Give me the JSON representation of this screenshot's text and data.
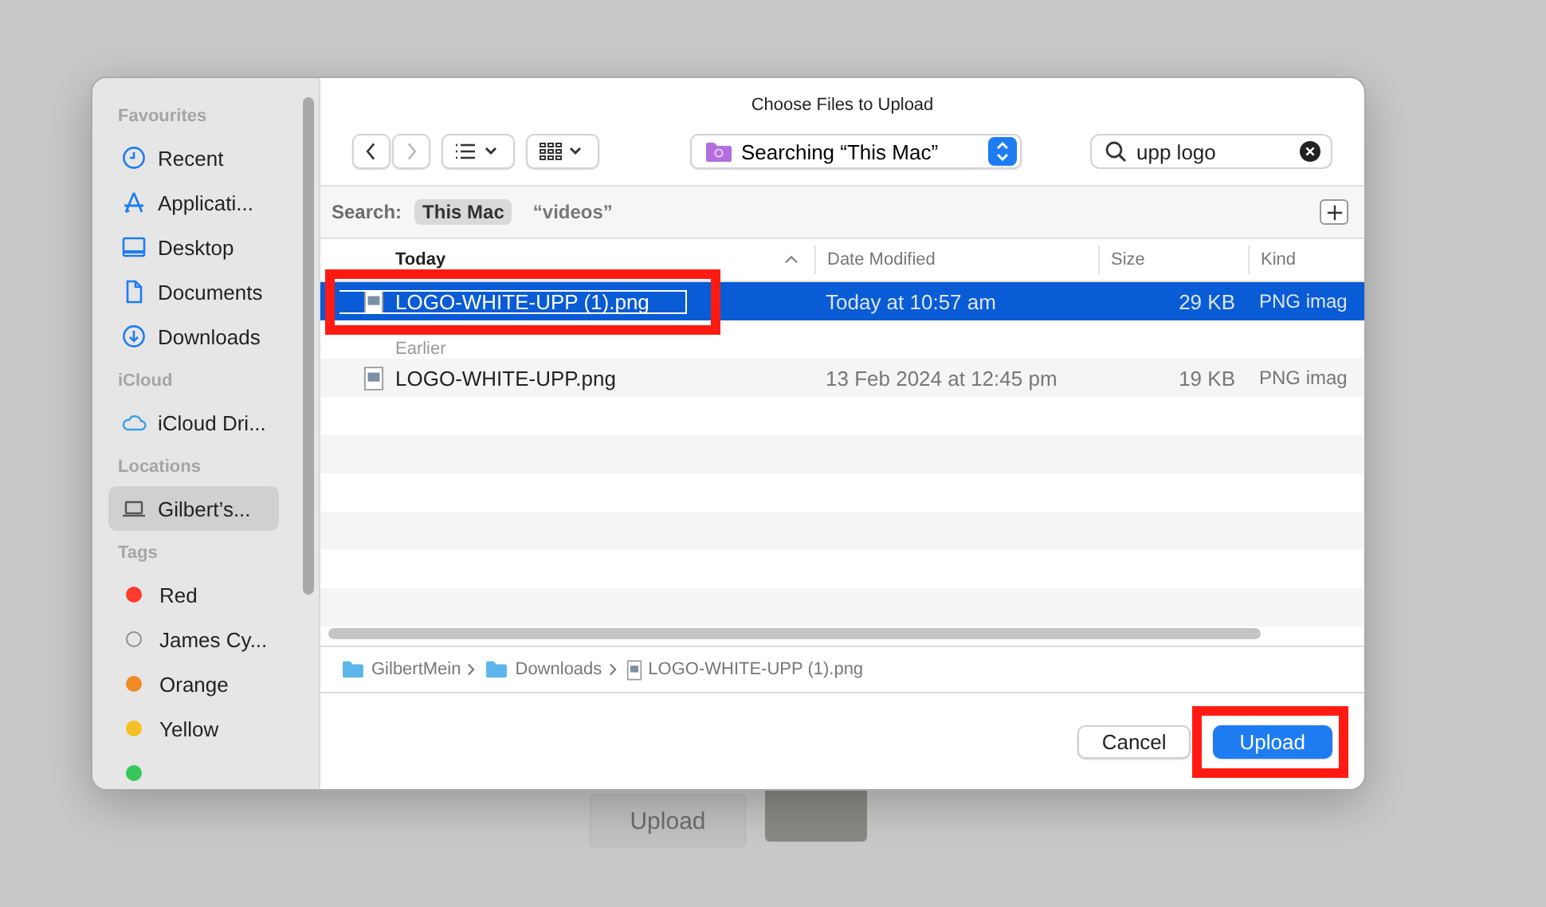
{
  "background": {
    "button": "Upload"
  },
  "dialog": {
    "title": "Choose Files to Upload"
  },
  "sidebar": {
    "sections": [
      {
        "heading": "Favourites",
        "items": [
          {
            "label": "Recent",
            "selected": false
          },
          {
            "label": "Applicati...",
            "selected": false
          },
          {
            "label": "Desktop",
            "selected": false
          },
          {
            "label": "Documents",
            "selected": false
          },
          {
            "label": "Downloads",
            "selected": false
          }
        ]
      },
      {
        "heading": "iCloud",
        "items": [
          {
            "label": "iCloud Dri...",
            "selected": false
          }
        ]
      },
      {
        "heading": "Locations",
        "items": [
          {
            "label": "Gilbert’s...",
            "selected": true
          }
        ]
      },
      {
        "heading": "Tags",
        "tags": [
          {
            "label": "Red",
            "color": "#ff3b30",
            "outlined": false
          },
          {
            "label": "James Cy...",
            "color": "#8e8e93",
            "outlined": true
          },
          {
            "label": "Orange",
            "color": "#f08a24",
            "outlined": false
          },
          {
            "label": "Yellow",
            "color": "#f4c025",
            "outlined": false
          },
          {
            "color": "#34c759",
            "outlined": false
          }
        ]
      }
    ]
  },
  "toolbar": {
    "location": "Searching “This Mac”",
    "search": {
      "value": "upp logo"
    }
  },
  "scope_bar": {
    "label": "Search:",
    "scopes": [
      {
        "label": "This Mac",
        "selected": true
      },
      {
        "label": "“videos”",
        "selected": false
      }
    ]
  },
  "table": {
    "columns": [
      "Today",
      "Date Modified",
      "Size",
      "Kind"
    ],
    "rows": [
      {
        "kind": "file",
        "name": "LOGO-WHITE-UPP (1).png",
        "date": "Today at 10:57 am",
        "size": "29 KB",
        "type": "PNG imag",
        "selected": true,
        "highlighted": true
      },
      {
        "kind": "group",
        "label": "Earlier"
      },
      {
        "kind": "file",
        "name": "LOGO-WHITE-UPP.png",
        "date": "13 Feb 2024 at 12:45 pm",
        "size": "19 KB",
        "type": "PNG imag",
        "selected": false,
        "highlighted": false
      }
    ]
  },
  "path_bar": [
    {
      "label": "GilbertMein",
      "kind": "folder"
    },
    {
      "label": "Downloads",
      "kind": "folder"
    },
    {
      "label": "LOGO-WHITE-UPP (1).png",
      "kind": "file"
    }
  ],
  "buttons": [
    {
      "label": "Cancel",
      "primary": false,
      "highlighted": false
    },
    {
      "label": "Upload",
      "primary": true,
      "highlighted": true
    }
  ]
}
